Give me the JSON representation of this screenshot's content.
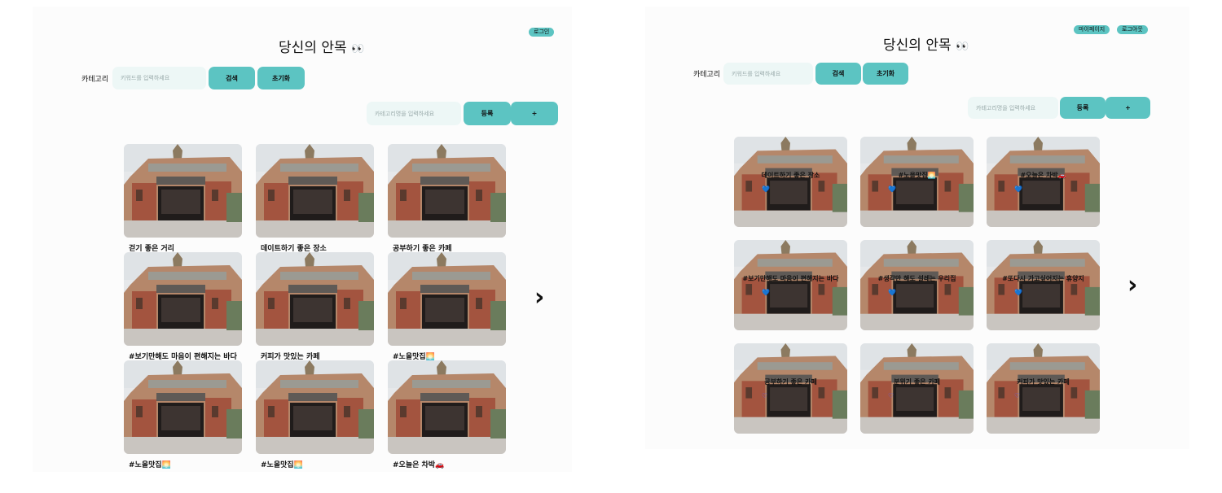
{
  "left": {
    "login_label": "로그인",
    "title": "당신의 안목",
    "title_emoji": "👀",
    "category_label": "카테고리",
    "keyword_placeholder": "키워드를 입력하세요",
    "search_label": "검색",
    "reset_label": "초기화",
    "category_input_placeholder": "카테고리명을 입력하세요",
    "register_label": "등록",
    "add_label": "+",
    "next_icon": "chevron-right-icon",
    "cards": [
      {
        "caption": "걷기 좋은 거리"
      },
      {
        "caption": "데이트하기 좋은 장소"
      },
      {
        "caption": "공부하기 좋은 카페"
      },
      {
        "caption": "#보기만해도 마음이 편해지는 바다"
      },
      {
        "caption": "커피가 맛있는 카페"
      },
      {
        "caption": "#노을맛집🌅"
      },
      {
        "caption": "#노을맛집🌅"
      },
      {
        "caption": "#노을맛집🌅"
      },
      {
        "caption": "#오늘은 차박🚗"
      }
    ]
  },
  "right": {
    "mypage_label": "마이페이지",
    "logout_label": "로그아웃",
    "title": "당신의 안목",
    "title_emoji": "👀",
    "category_label": "카테고리",
    "keyword_placeholder": "키워드를 입력하세요",
    "search_label": "검색",
    "reset_label": "초기화",
    "category_input_placeholder": "카테고리명을 입력하세요",
    "register_label": "등록",
    "add_label": "+",
    "next_icon": "chevron-right-icon",
    "cards": [
      {
        "overlay": "데이트하기 좋은 장소",
        "heart": "💙"
      },
      {
        "overlay": "#노을맛집🌅",
        "heart": "💙"
      },
      {
        "overlay": "#오늘은 차박🚗",
        "heart": "💙"
      },
      {
        "overlay": "#보기만해도 마음이 편해지는 바다",
        "heart": "💙"
      },
      {
        "overlay": "#생각만 해도 설레는 우리집",
        "heart": "💙"
      },
      {
        "overlay": "#또다시 가고싶어지는 휴양지",
        "heart": "💙"
      },
      {
        "overlay": "공부하기 좋은 카페",
        "heart": "♡"
      },
      {
        "overlay": "분위기 좋은 카페",
        "heart": "♡"
      },
      {
        "overlay": "커피가 맛있는 카페",
        "heart": "♡"
      }
    ]
  },
  "colors": {
    "accent": "#5cc4c2",
    "input_bg": "#edf7f6",
    "heart": "#5b62f4"
  }
}
